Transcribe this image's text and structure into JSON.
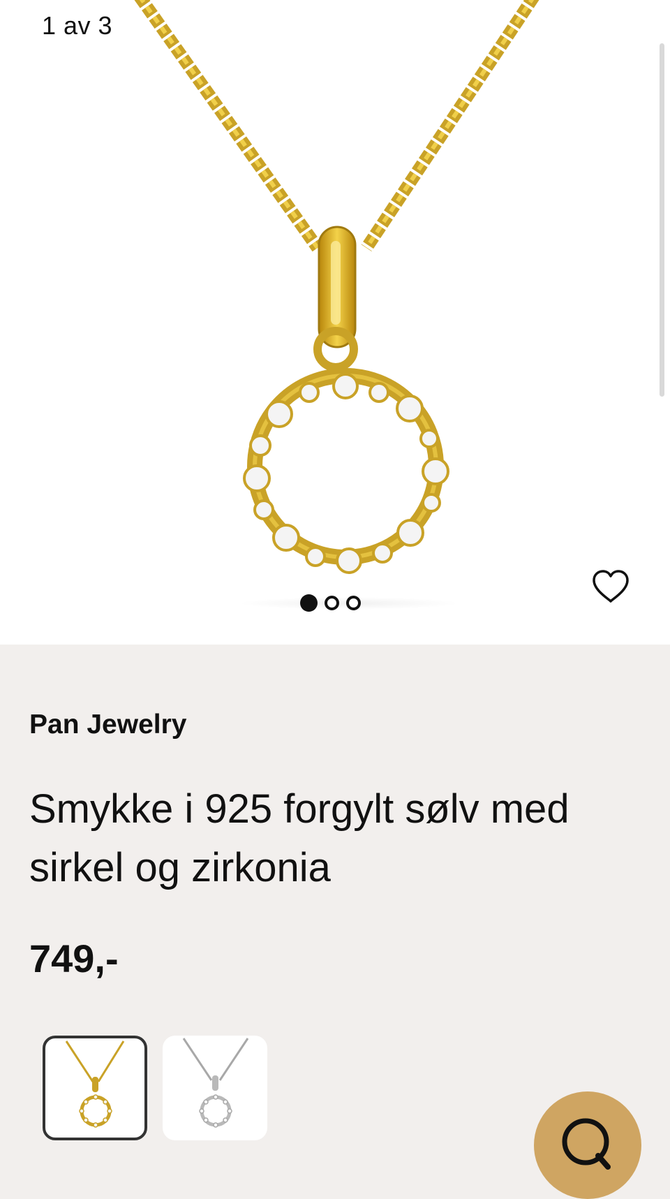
{
  "gallery": {
    "counter": "1 av 3",
    "dots": [
      {
        "active": true
      },
      {
        "active": false
      },
      {
        "active": false
      }
    ]
  },
  "product": {
    "brand": "Pan Jewelry",
    "title": "Smykke i 925 forgylt sølv med sirkel og zirkonia",
    "price": "749,-"
  },
  "variants": [
    {
      "color": "gold",
      "selected": true
    },
    {
      "color": "silver",
      "selected": false
    }
  ],
  "colors": {
    "gold": "#c9a227",
    "silver": "#b9b9b9",
    "chat_button": "#cfa562",
    "info_background": "#f2efed"
  },
  "icons": {
    "favorite": "heart-icon",
    "chat": "chat-bubble-icon"
  }
}
